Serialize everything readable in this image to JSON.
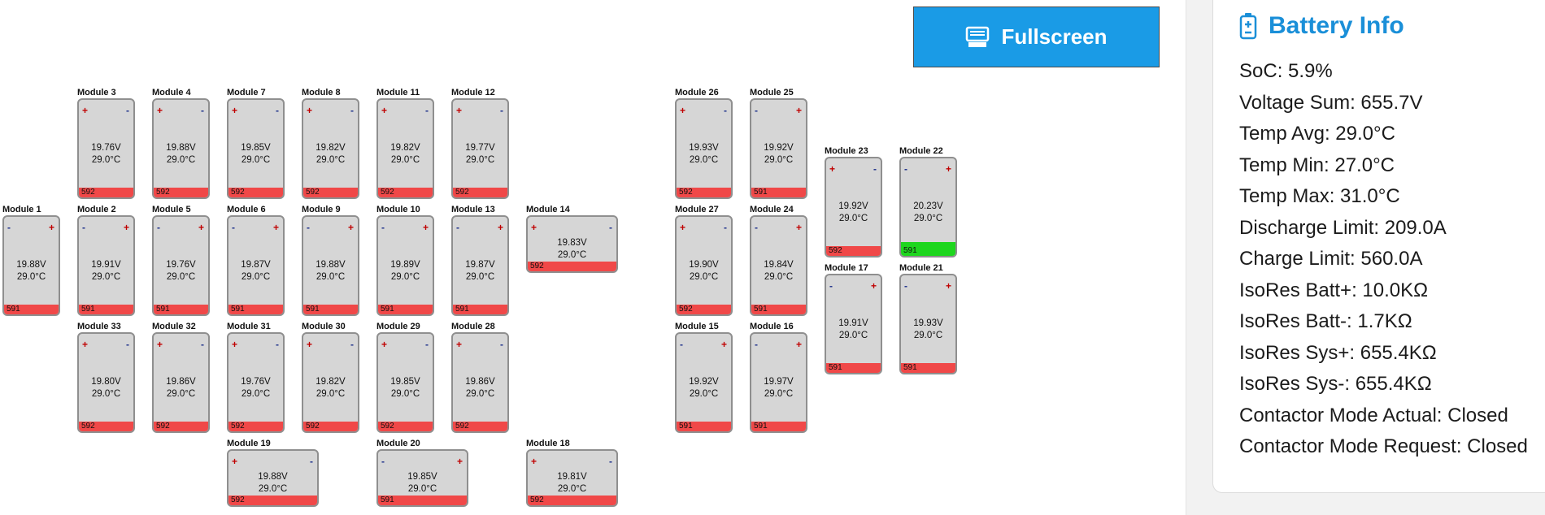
{
  "toolbar": {
    "fullscreen_label": "Fullscreen",
    "fullscreen_icon": "display-icon"
  },
  "battery_info": {
    "title": "Battery Info",
    "icon": "battery-icon",
    "accent_color": "#1a8fd8",
    "lines": [
      "SoC: 5.9%",
      "Voltage Sum: 655.7V",
      "Temp Avg: 29.0°C",
      "Temp Min: 27.0°C",
      "Temp Max: 31.0°C",
      "Discharge Limit: 209.0A",
      "Charge Limit: 560.0A",
      "IsoRes Batt+: 10.0KΩ",
      "IsoRes Batt-: 1.7KΩ",
      "IsoRes Sys+: 655.4KΩ",
      "IsoRes Sys-: 655.4KΩ",
      "Contactor Mode Actual: Closed",
      "Contactor Mode Request: Closed"
    ]
  },
  "colors": {
    "status_red": "#f04848",
    "status_green": "#1ed61e",
    "button_blue": "#1a9be6"
  },
  "modules": [
    {
      "name": "Module 3",
      "voltage": "19.76V",
      "temp": "29.0°C",
      "count": "592",
      "left_term": "+",
      "right_term": "-",
      "status": "red"
    },
    {
      "name": "Module 4",
      "voltage": "19.88V",
      "temp": "29.0°C",
      "count": "592",
      "left_term": "+",
      "right_term": "-",
      "status": "red"
    },
    {
      "name": "Module 7",
      "voltage": "19.85V",
      "temp": "29.0°C",
      "count": "592",
      "left_term": "+",
      "right_term": "-",
      "status": "red"
    },
    {
      "name": "Module 8",
      "voltage": "19.82V",
      "temp": "29.0°C",
      "count": "592",
      "left_term": "+",
      "right_term": "-",
      "status": "red"
    },
    {
      "name": "Module 11",
      "voltage": "19.82V",
      "temp": "29.0°C",
      "count": "592",
      "left_term": "+",
      "right_term": "-",
      "status": "red"
    },
    {
      "name": "Module 12",
      "voltage": "19.77V",
      "temp": "29.0°C",
      "count": "592",
      "left_term": "+",
      "right_term": "-",
      "status": "red"
    },
    {
      "name": "Module 26",
      "voltage": "19.93V",
      "temp": "29.0°C",
      "count": "592",
      "left_term": "+",
      "right_term": "-",
      "status": "red"
    },
    {
      "name": "Module 25",
      "voltage": "19.92V",
      "temp": "29.0°C",
      "count": "591",
      "left_term": "-",
      "right_term": "+",
      "status": "red"
    },
    {
      "name": "Module 23",
      "voltage": "19.92V",
      "temp": "29.0°C",
      "count": "592",
      "left_term": "+",
      "right_term": "-",
      "status": "red"
    },
    {
      "name": "Module 22",
      "voltage": "20.23V",
      "temp": "29.0°C",
      "count": "591",
      "left_term": "-",
      "right_term": "+",
      "status": "green"
    },
    {
      "name": "Module 1",
      "voltage": "19.88V",
      "temp": "29.0°C",
      "count": "591",
      "left_term": "-",
      "right_term": "+",
      "status": "red"
    },
    {
      "name": "Module 2",
      "voltage": "19.91V",
      "temp": "29.0°C",
      "count": "591",
      "left_term": "-",
      "right_term": "+",
      "status": "red"
    },
    {
      "name": "Module 5",
      "voltage": "19.76V",
      "temp": "29.0°C",
      "count": "591",
      "left_term": "-",
      "right_term": "+",
      "status": "red"
    },
    {
      "name": "Module 6",
      "voltage": "19.87V",
      "temp": "29.0°C",
      "count": "591",
      "left_term": "-",
      "right_term": "+",
      "status": "red"
    },
    {
      "name": "Module 9",
      "voltage": "19.88V",
      "temp": "29.0°C",
      "count": "591",
      "left_term": "-",
      "right_term": "+",
      "status": "red"
    },
    {
      "name": "Module 10",
      "voltage": "19.89V",
      "temp": "29.0°C",
      "count": "591",
      "left_term": "-",
      "right_term": "+",
      "status": "red"
    },
    {
      "name": "Module 13",
      "voltage": "19.87V",
      "temp": "29.0°C",
      "count": "591",
      "left_term": "-",
      "right_term": "+",
      "status": "red"
    },
    {
      "name": "Module 14",
      "voltage": "19.83V",
      "temp": "29.0°C",
      "count": "592",
      "left_term": "+",
      "right_term": "-",
      "status": "red"
    },
    {
      "name": "Module 27",
      "voltage": "19.90V",
      "temp": "29.0°C",
      "count": "592",
      "left_term": "+",
      "right_term": "-",
      "status": "red"
    },
    {
      "name": "Module 24",
      "voltage": "19.84V",
      "temp": "29.0°C",
      "count": "591",
      "left_term": "-",
      "right_term": "+",
      "status": "red"
    },
    {
      "name": "Module 17",
      "voltage": "19.91V",
      "temp": "29.0°C",
      "count": "591",
      "left_term": "-",
      "right_term": "+",
      "status": "red"
    },
    {
      "name": "Module 21",
      "voltage": "19.93V",
      "temp": "29.0°C",
      "count": "591",
      "left_term": "-",
      "right_term": "+",
      "status": "red"
    },
    {
      "name": "Module 33",
      "voltage": "19.80V",
      "temp": "29.0°C",
      "count": "592",
      "left_term": "+",
      "right_term": "-",
      "status": "red"
    },
    {
      "name": "Module 32",
      "voltage": "19.86V",
      "temp": "29.0°C",
      "count": "592",
      "left_term": "+",
      "right_term": "-",
      "status": "red"
    },
    {
      "name": "Module 31",
      "voltage": "19.76V",
      "temp": "29.0°C",
      "count": "592",
      "left_term": "+",
      "right_term": "-",
      "status": "red"
    },
    {
      "name": "Module 30",
      "voltage": "19.82V",
      "temp": "29.0°C",
      "count": "592",
      "left_term": "+",
      "right_term": "-",
      "status": "red"
    },
    {
      "name": "Module 29",
      "voltage": "19.85V",
      "temp": "29.0°C",
      "count": "592",
      "left_term": "+",
      "right_term": "-",
      "status": "red"
    },
    {
      "name": "Module 28",
      "voltage": "19.86V",
      "temp": "29.0°C",
      "count": "592",
      "left_term": "+",
      "right_term": "-",
      "status": "red"
    },
    {
      "name": "Module 15",
      "voltage": "19.92V",
      "temp": "29.0°C",
      "count": "591",
      "left_term": "-",
      "right_term": "+",
      "status": "red"
    },
    {
      "name": "Module 16",
      "voltage": "19.97V",
      "temp": "29.0°C",
      "count": "591",
      "left_term": "-",
      "right_term": "+",
      "status": "red"
    },
    {
      "name": "Module 19",
      "voltage": "19.88V",
      "temp": "29.0°C",
      "count": "592",
      "left_term": "+",
      "right_term": "-",
      "status": "red"
    },
    {
      "name": "Module 20",
      "voltage": "19.85V",
      "temp": "29.0°C",
      "count": "591",
      "left_term": "-",
      "right_term": "+",
      "status": "red"
    },
    {
      "name": "Module 18",
      "voltage": "19.81V",
      "temp": "29.0°C",
      "count": "592",
      "left_term": "+",
      "right_term": "-",
      "status": "red"
    }
  ]
}
